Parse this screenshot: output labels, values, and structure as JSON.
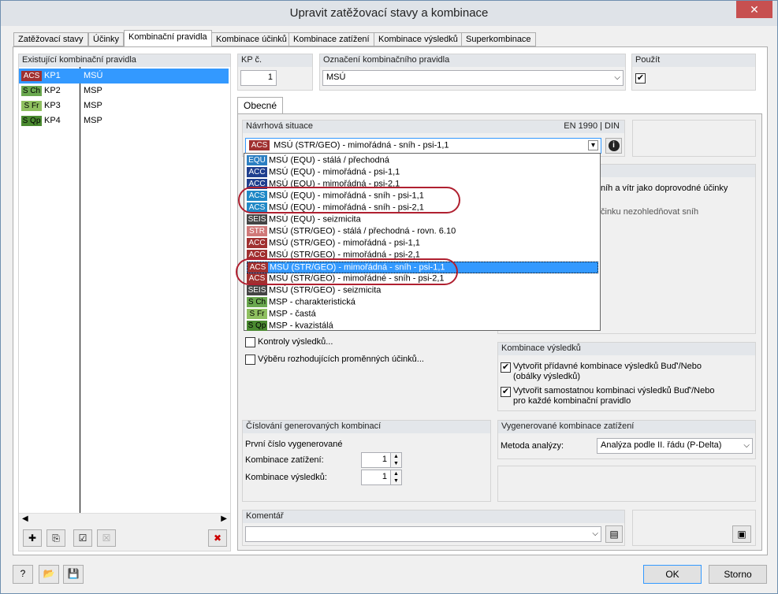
{
  "window": {
    "title": "Upravit zatěžovací stavy a kombinace",
    "close": "✕"
  },
  "tabs": [
    "Zatěžovací stavy",
    "Účinky",
    "Kombinační pravidla",
    "Kombinace účinků",
    "Kombinace zatížení",
    "Kombinace výsledků",
    "Superkombinace"
  ],
  "left": {
    "header": "Existující kombinační pravidla",
    "rows": [
      {
        "badge": "ACS",
        "id": "KP1",
        "name": "MSÚ"
      },
      {
        "badge": "S Ch",
        "id": "KP2",
        "name": "MSP"
      },
      {
        "badge": "S Fr",
        "id": "KP3",
        "name": "MSP"
      },
      {
        "badge": "S Qp",
        "id": "KP4",
        "name": "MSP"
      }
    ]
  },
  "kp": {
    "label": "KP č.",
    "value": "1"
  },
  "oznaceni": {
    "label": "Označení kombinačního pravidla",
    "value": "MSÚ"
  },
  "pouzit": {
    "label": "Použít",
    "checked": "✔"
  },
  "subtab": "Obecné",
  "navrhova": {
    "label": "Návrhová situace",
    "norm": "EN 1990 | DIN",
    "selected_badge": "ACS",
    "selected": "MSÚ (STR/GEO) - mimořádná - sníh - psi-1,1",
    "items": [
      {
        "badge": "EQU",
        "text": "MSÚ (EQU) - stálá / přechodná"
      },
      {
        "badge": "ACC",
        "text": "MSÚ (EQU) - mimořádná - psi-1,1"
      },
      {
        "badge": "ACC",
        "text": "MSÚ (EQU) - mimořádná - psi-2,1"
      },
      {
        "badge": "ACS",
        "text": "MSÚ (EQU) - mimořádná - sníh - psi-1,1"
      },
      {
        "badge": "ACS",
        "text": "MSÚ (EQU) - mimořádná - sníh - psi-2,1"
      },
      {
        "badge": "SEIS",
        "text": "MSÚ (EQU) - seizmicita"
      },
      {
        "badge": "STR",
        "text": "MSÚ (STR/GEO) - stálá / přechodná - rovn. 6.10"
      },
      {
        "badge": "ACC",
        "text": "MSÚ (STR/GEO) - mimořádná - psi-1,1"
      },
      {
        "badge": "ACC",
        "text": "MSÚ (STR/GEO) - mimořádná - psi-2,1"
      },
      {
        "badge": "ACS",
        "text": "MSÚ (STR/GEO) - mimořádná - sníh - psi-1,1"
      },
      {
        "badge": "ACS",
        "text": "MSÚ (STR/GEO) - mimořádné - sníh - psi-2,1"
      },
      {
        "badge": "SEIS",
        "text": "MSÚ (STR/GEO) - seizmicita"
      },
      {
        "badge": "S Ch",
        "text": "MSP - charakteristická"
      },
      {
        "badge": "S Fr",
        "text": "MSP - častá"
      },
      {
        "badge": "S Qp",
        "text": "MSP - kvazistálá"
      }
    ]
  },
  "hidden_right": {
    "text1": "níh a vítr jako doprovodné účinky",
    "text2": "činku nezohledňovat sníh"
  },
  "kontroly": "Kontroly výsledků...",
  "vyberu": "Výběru rozhodujících proměnných účinků...",
  "kombinace_vysledku": {
    "header": "Kombinace výsledků",
    "opt1_l1": "Vytvořit přídavné kombinace výsledků Buď'/Nebo",
    "opt1_l2": "(obálky výsledků)",
    "opt2_l1": "Vytvořit samostatnou kombinaci výsledků Buď'/Nebo",
    "opt2_l2": "pro každé kombinační pravidlo",
    "check": "✔"
  },
  "cislovani": {
    "header": "Číslování generovaných kombinací",
    "prvni": "První číslo vygenerované",
    "kz_label": "Kombinace zatížení:",
    "kz_value": "1",
    "kv_label": "Kombinace výsledků:",
    "kv_value": "1"
  },
  "vygenerovane": {
    "header": "Vygenerované kombinace zatížení",
    "metoda_label": "Metoda analýzy:",
    "metoda_value": "Analýza podle II. řádu (P-Delta)"
  },
  "komentar": {
    "label": "Komentář",
    "value": ""
  },
  "buttons": {
    "ok": "OK",
    "storno": "Storno"
  }
}
